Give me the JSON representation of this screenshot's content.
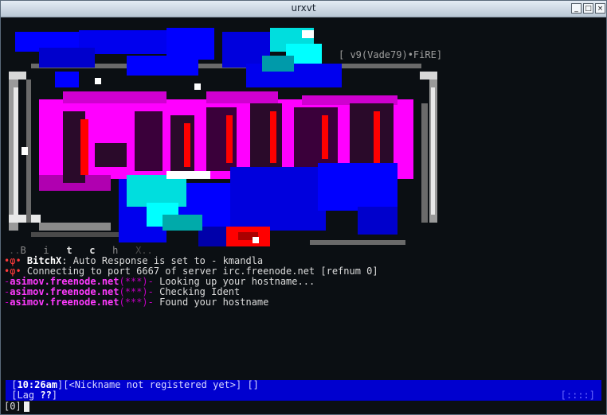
{
  "window": {
    "title": "urxvt"
  },
  "window_buttons": [
    "_",
    "□",
    "×"
  ],
  "banner": {
    "version": "[ v9(Vade79)•FiRE]",
    "letters": [
      ".",
      ".",
      "B",
      "i",
      "t",
      "c",
      "h",
      "X",
      ".",
      "."
    ]
  },
  "messages": [
    {
      "prefix": "•φ•",
      "source": "BitchX",
      "sep": ":",
      "text": " Auto Response is set to - kmandla"
    },
    {
      "prefix": "•φ•",
      "source": "",
      "sep": "",
      "text": " Connecting to port 6667 of server irc.freenode.net [refnum 0]"
    },
    {
      "prefix": "-",
      "source": "asimov.freenode.net",
      "sep": "(***)-",
      "text": " Looking up your hostname..."
    },
    {
      "prefix": "-",
      "source": "asimov.freenode.net",
      "sep": "(***)-",
      "text": " Checking Ident"
    },
    {
      "prefix": "-",
      "source": "asimov.freenode.net",
      "sep": "(***)-",
      "text": " Found your hostname"
    }
  ],
  "status": {
    "time": "10:26am",
    "nick": "<Nickname not registered yet>",
    "trail": " []",
    "lag_label": "Lag",
    "lag_value": "??",
    "right": "[::::]"
  },
  "input": {
    "prompt": "[0]"
  },
  "colors": {
    "magenta": "#ff00ff",
    "blue": "#0000ff",
    "cyan": "#00ffff",
    "red": "#ff0000",
    "status_bar": "#0000cf"
  }
}
